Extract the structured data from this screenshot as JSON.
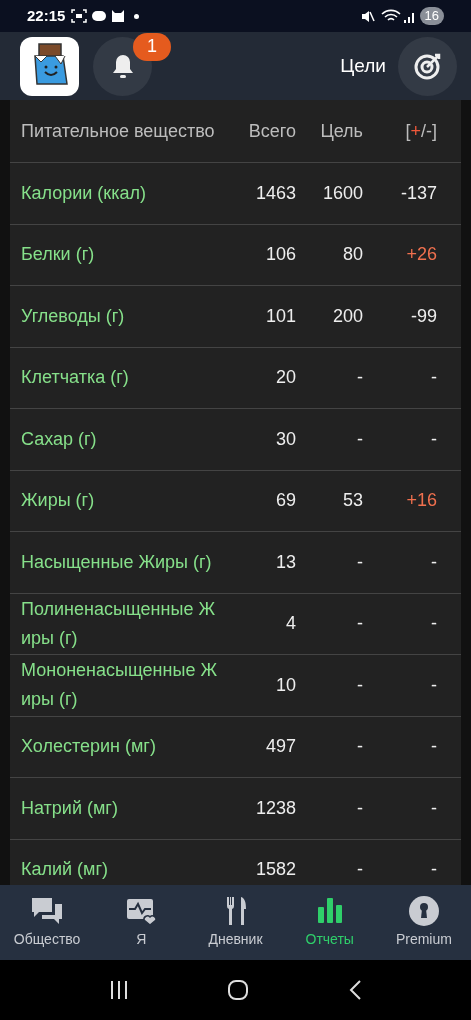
{
  "status_bar": {
    "time": "22:15",
    "battery": "16"
  },
  "header": {
    "notifications": {
      "count": "1"
    },
    "goals_label": "Цели"
  },
  "table": {
    "columns": [
      "Питательное вещество",
      "Всего",
      "Цель"
    ],
    "diff_column": {
      "prefix": "[",
      "highlight": "+",
      "suffix": "/-]"
    },
    "rows": [
      {
        "name": "Калории (ккал)",
        "total": "1463",
        "goal": "1600",
        "diff": "-137",
        "over": false
      },
      {
        "name": "Белки (г)",
        "total": "106",
        "goal": "80",
        "diff": "+26",
        "over": true
      },
      {
        "name": "Углеводы (г)",
        "total": "101",
        "goal": "200",
        "diff": "-99",
        "over": false
      },
      {
        "name": "Клетчатка (г)",
        "total": "20",
        "goal": "-",
        "diff": "-",
        "over": false
      },
      {
        "name": "Сахар (г)",
        "total": "30",
        "goal": "-",
        "diff": "-",
        "over": false
      },
      {
        "name": "Жиры (г)",
        "total": "69",
        "goal": "53",
        "diff": "+16",
        "over": true
      },
      {
        "name": "Насыщенные Жиры (г)",
        "total": "13",
        "goal": "-",
        "diff": "-",
        "over": false
      },
      {
        "name": "Полиненасыщенные Жиры (г)",
        "total": "4",
        "goal": "-",
        "diff": "-",
        "over": false
      },
      {
        "name": "Мононенасыщенные Жиры (г)",
        "total": "10",
        "goal": "-",
        "diff": "-",
        "over": false
      },
      {
        "name": "Холестерин (мг)",
        "total": "497",
        "goal": "-",
        "diff": "-",
        "over": false
      },
      {
        "name": "Натрий (мг)",
        "total": "1238",
        "goal": "-",
        "diff": "-",
        "over": false
      },
      {
        "name": "Калий (мг)",
        "total": "1582",
        "goal": "-",
        "diff": "-",
        "over": false
      }
    ]
  },
  "bottom_nav": [
    {
      "kind": "community",
      "label": "Общество",
      "selected": false
    },
    {
      "kind": "me",
      "label": "Я",
      "selected": false
    },
    {
      "kind": "diary",
      "label": "Дневник",
      "selected": false
    },
    {
      "kind": "reports",
      "label": "Отчеты",
      "selected": true
    },
    {
      "kind": "premium",
      "label": "Premium",
      "selected": false
    }
  ]
}
